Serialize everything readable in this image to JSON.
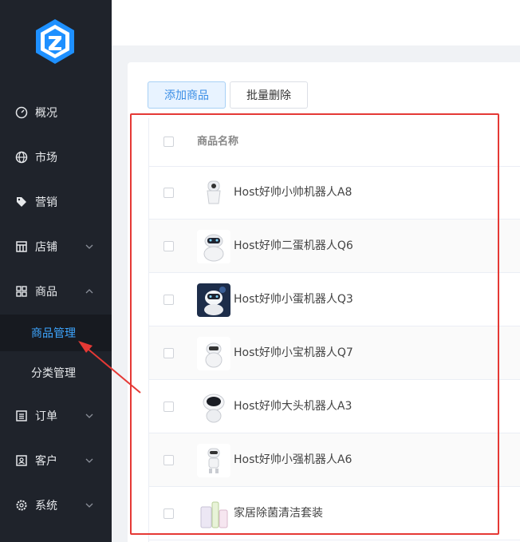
{
  "sidebar": {
    "items": [
      {
        "label": "概况",
        "icon": "speedometer-icon"
      },
      {
        "label": "市场",
        "icon": "globe-icon"
      },
      {
        "label": "营销",
        "icon": "tag-icon"
      },
      {
        "label": "店铺",
        "icon": "store-icon",
        "expanded": false
      },
      {
        "label": "商品",
        "icon": "grid-icon",
        "expanded": true
      },
      {
        "label": "订单",
        "icon": "list-icon",
        "expanded": false
      },
      {
        "label": "客户",
        "icon": "user-card-icon",
        "expanded": false
      },
      {
        "label": "系统",
        "icon": "settings-icon",
        "expanded": false
      }
    ],
    "sub_items": [
      {
        "label": "商品管理",
        "active": true
      },
      {
        "label": "分类管理",
        "active": false
      }
    ]
  },
  "toolbar": {
    "add_label": "添加商品",
    "bulk_delete_label": "批量删除"
  },
  "table": {
    "columns": [
      "商品名称"
    ],
    "rows": [
      {
        "name": "Host好帅小帅机器人A8"
      },
      {
        "name": "Host好帅二蛋机器人Q6"
      },
      {
        "name": "Host好帅小蛋机器人Q3"
      },
      {
        "name": "Host好帅小宝机器人Q7"
      },
      {
        "name": "Host好帅大头机器人A3"
      },
      {
        "name": "Host好帅小强机器人A6"
      },
      {
        "name": "家居除菌清洁套装"
      }
    ]
  },
  "colors": {
    "sidebar_bg": "#1f232b",
    "active_text": "#3ea6ff",
    "primary": "#3a8ee6",
    "highlight": "#e53935"
  }
}
